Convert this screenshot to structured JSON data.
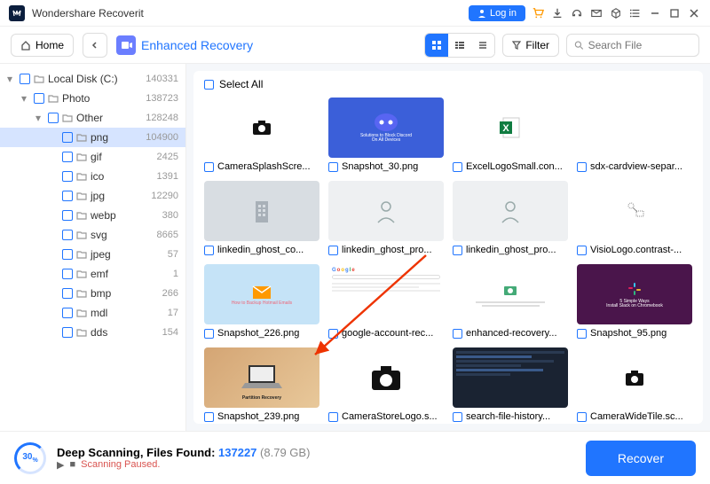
{
  "app": {
    "title": "Wondershare Recoverit",
    "login_label": "Log in"
  },
  "toolbar": {
    "home": "Home",
    "mode": "Enhanced Recovery",
    "filter": "Filter",
    "search_placeholder": "Search File"
  },
  "sidebar": {
    "items": [
      {
        "label": "Local Disk (C:)",
        "count": 140331,
        "indent": 0,
        "caret": "▾",
        "selected": false
      },
      {
        "label": "Photo",
        "count": 138723,
        "indent": 1,
        "caret": "▾",
        "selected": false
      },
      {
        "label": "Other",
        "count": 128248,
        "indent": 2,
        "caret": "▾",
        "selected": false
      },
      {
        "label": "png",
        "count": 104900,
        "indent": 3,
        "caret": "",
        "selected": true
      },
      {
        "label": "gif",
        "count": 2425,
        "indent": 3,
        "caret": "",
        "selected": false
      },
      {
        "label": "ico",
        "count": 1391,
        "indent": 3,
        "caret": "",
        "selected": false
      },
      {
        "label": "jpg",
        "count": 12290,
        "indent": 3,
        "caret": "",
        "selected": false
      },
      {
        "label": "webp",
        "count": 380,
        "indent": 3,
        "caret": "",
        "selected": false
      },
      {
        "label": "svg",
        "count": 8665,
        "indent": 3,
        "caret": "",
        "selected": false
      },
      {
        "label": "jpeg",
        "count": 57,
        "indent": 3,
        "caret": "",
        "selected": false
      },
      {
        "label": "emf",
        "count": 1,
        "indent": 3,
        "caret": "",
        "selected": false
      },
      {
        "label": "bmp",
        "count": 266,
        "indent": 3,
        "caret": "",
        "selected": false
      },
      {
        "label": "mdl",
        "count": 17,
        "indent": 3,
        "caret": "",
        "selected": false
      },
      {
        "label": "dds",
        "count": 154,
        "indent": 3,
        "caret": "",
        "selected": false
      }
    ]
  },
  "content": {
    "select_all_label": "Select All",
    "files": [
      {
        "name": "CameraSplashScre...",
        "thumb_type": "camera"
      },
      {
        "name": "Snapshot_30.png",
        "thumb_type": "discord"
      },
      {
        "name": "ExcelLogoSmall.con...",
        "thumb_type": "excel"
      },
      {
        "name": "sdx-cardview-separ...",
        "thumb_type": "blank"
      },
      {
        "name": "linkedin_ghost_co...",
        "thumb_type": "building"
      },
      {
        "name": "linkedin_ghost_pro...",
        "thumb_type": "person"
      },
      {
        "name": "linkedin_ghost_pro...",
        "thumb_type": "person"
      },
      {
        "name": "VisioLogo.contrast-...",
        "thumb_type": "visio"
      },
      {
        "name": "Snapshot_226.png",
        "thumb_type": "email"
      },
      {
        "name": "google-account-rec...",
        "thumb_type": "google"
      },
      {
        "name": "enhanced-recovery...",
        "thumb_type": "recovery"
      },
      {
        "name": "Snapshot_95.png",
        "thumb_type": "slack"
      },
      {
        "name": "Snapshot_239.png",
        "thumb_type": "laptop"
      },
      {
        "name": "CameraStoreLogo.s...",
        "thumb_type": "camera-big"
      },
      {
        "name": "search-file-history...",
        "thumb_type": "dark"
      },
      {
        "name": "CameraWideTile.sc...",
        "thumb_type": "camera-wide"
      }
    ]
  },
  "footer": {
    "percent": "30",
    "status_prefix": "Deep Scanning, Files Found:",
    "found": "137227",
    "size": "(8.79 GB)",
    "paused": "Scanning Paused.",
    "recover_label": "Recover"
  }
}
